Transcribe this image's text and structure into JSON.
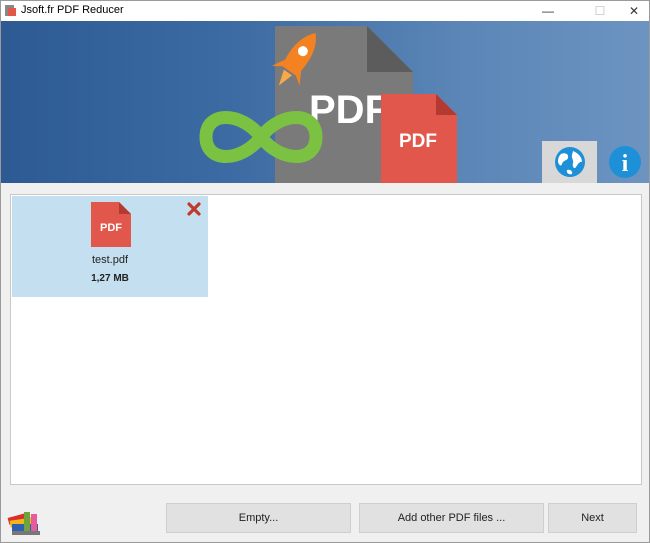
{
  "window": {
    "title": "Jsoft.fr PDF Reducer",
    "controls": {
      "minimize": "—",
      "maximize": "☐",
      "close": "✕"
    }
  },
  "banner": {
    "logo_text_back": "PDF",
    "logo_text_front": "PDF",
    "icons": [
      "globe-icon",
      "info-icon"
    ],
    "info_glyph": "i"
  },
  "files": [
    {
      "icon_label": "PDF",
      "name": "test.pdf",
      "size": "1,27 MB"
    }
  ],
  "buttons": {
    "empty": "Empty...",
    "add_other": "Add other PDF files ...",
    "next": "Next"
  },
  "colors": {
    "banner_start": "#2d5a92",
    "banner_end": "#6d94c1",
    "pdf_red": "#e2574c",
    "remove_red": "#c0392b",
    "selected_item": "#c4e0f0",
    "infinity_green": "#7cc242",
    "rocket_orange": "#f58220"
  }
}
